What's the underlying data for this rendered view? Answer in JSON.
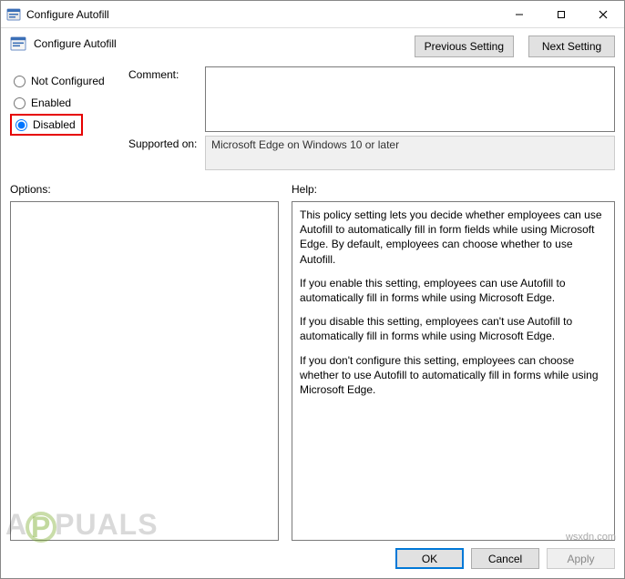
{
  "window": {
    "title": "Configure Autofill"
  },
  "header": {
    "title": "Configure Autofill",
    "prev_label": "Previous Setting",
    "next_label": "Next Setting"
  },
  "radios": {
    "not_configured": "Not Configured",
    "enabled": "Enabled",
    "disabled": "Disabled",
    "selected": "disabled"
  },
  "labels": {
    "comment": "Comment:",
    "supported_on": "Supported on:",
    "options": "Options:",
    "help": "Help:"
  },
  "fields": {
    "comment_value": "",
    "supported_on_value": "Microsoft Edge on Windows 10 or later",
    "options_value": ""
  },
  "help": {
    "p1": "This policy setting lets you decide whether employees can use Autofill to automatically fill in form fields while using Microsoft Edge. By default, employees can choose whether to use Autofill.",
    "p2": "If you enable this setting, employees can use Autofill to automatically fill in forms while using Microsoft Edge.",
    "p3": "If you disable this setting, employees can't use Autofill to automatically fill in forms while using Microsoft Edge.",
    "p4": "If you don't configure this setting, employees can choose whether to use Autofill to automatically fill in forms while using Microsoft Edge."
  },
  "footer": {
    "ok": "OK",
    "cancel": "Cancel",
    "apply": "Apply"
  },
  "watermark": {
    "pre": "A",
    "mid": "P",
    "post": "PUALS",
    "site": "wsxdn.com"
  }
}
